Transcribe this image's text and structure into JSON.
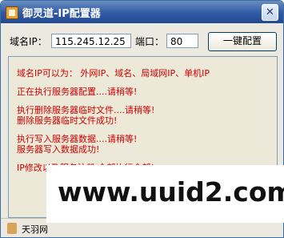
{
  "window": {
    "title": "御灵道-IP配置器",
    "close_glyph": "✕",
    "app_icon": "app-icon"
  },
  "form": {
    "domain_label": "域名IP：",
    "domain_value": "115.245.12.25",
    "port_label": "端口：",
    "port_value": "80",
    "one_click_button": "一键配置"
  },
  "log": {
    "lines": [
      "域名IP可以为： 外网IP、域名、局域网IP、单机IP",
      "正在执行服务器配置....请稍等!",
      "执行删除服务器临时文件....请稍等!",
      "删除服务器临时文件成功!",
      "执行写入服务器数据....请稍等!",
      "服务器写入数据成功!",
      "IP修改以及服务注册 全部执行全部!"
    ],
    "text_color": "#cc0000"
  },
  "statusbar": {
    "text": "天羽网"
  },
  "watermark": {
    "text": "www.uuid2.com"
  }
}
